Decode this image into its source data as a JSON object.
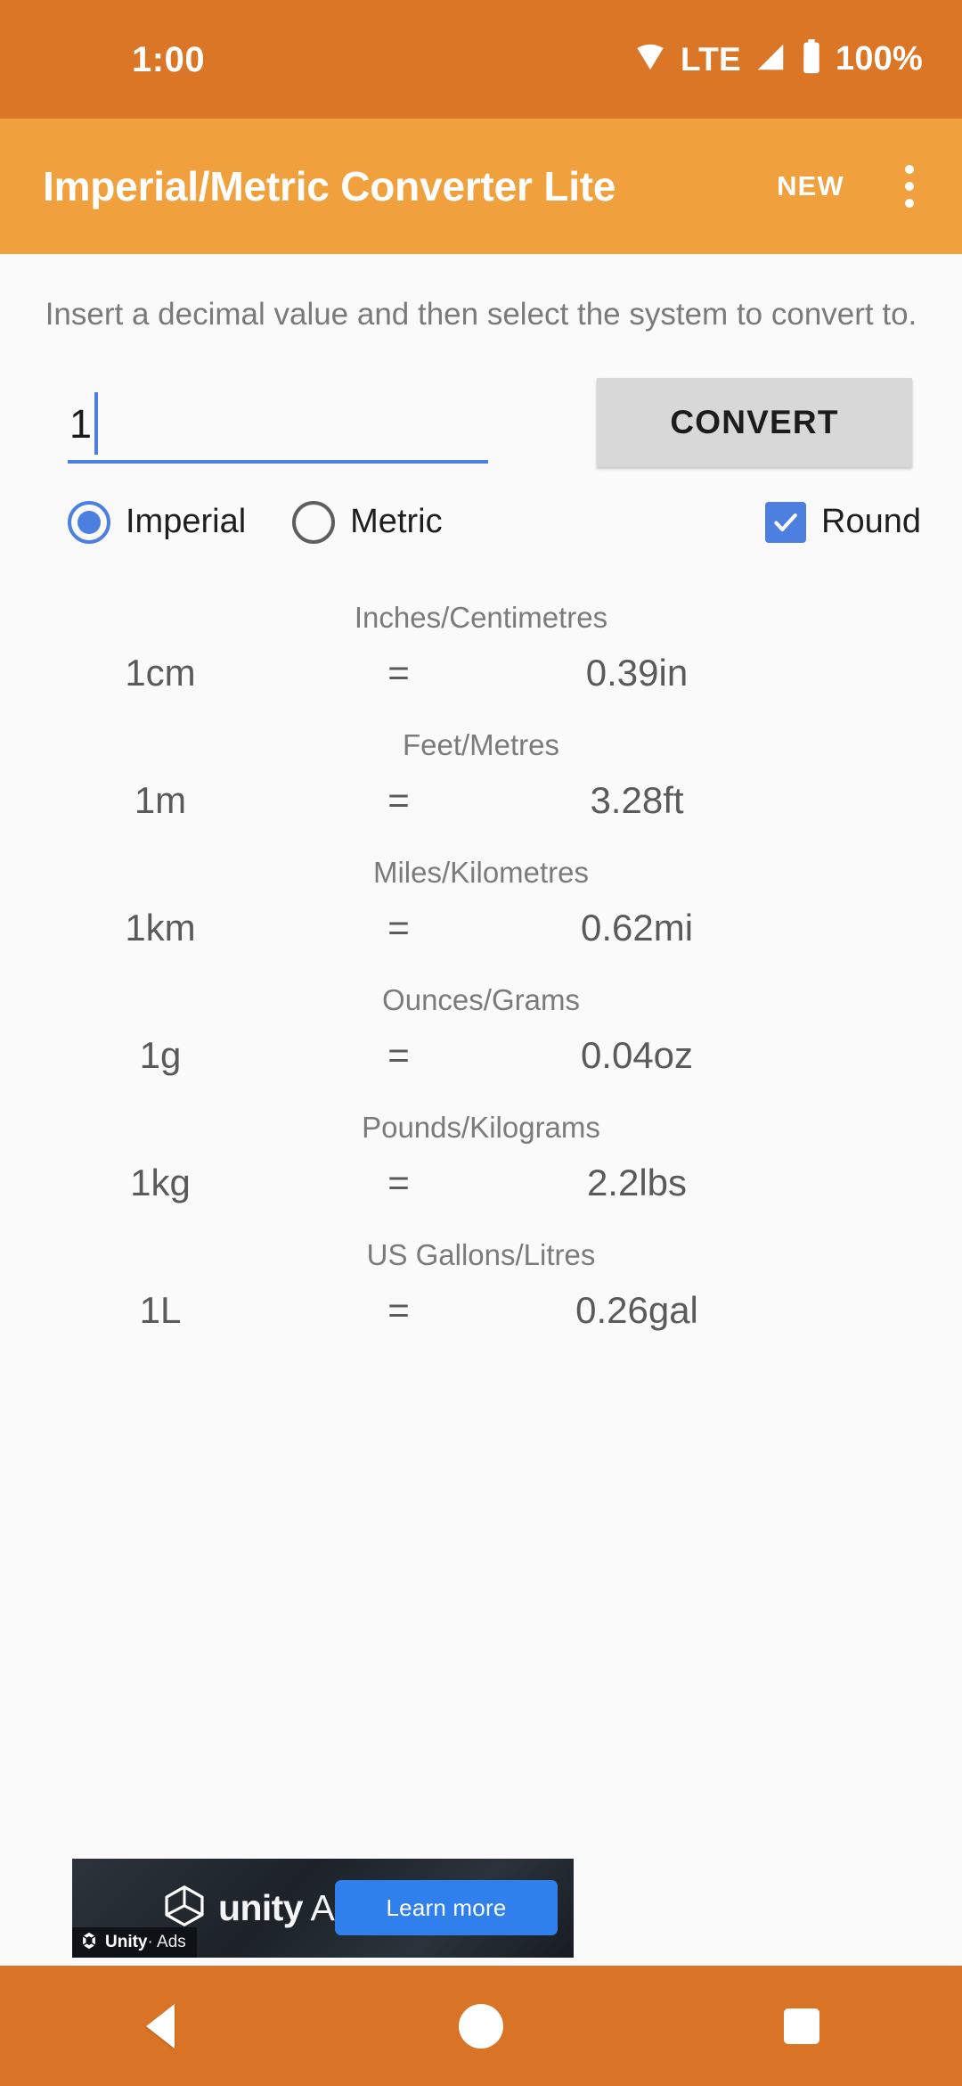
{
  "status_bar": {
    "clock": "1:00",
    "network_label": "LTE",
    "battery_label": "100%",
    "wifi_icon": "wifi-icon",
    "signal_icon": "cell-signal-icon",
    "battery_icon": "battery-full-icon",
    "background_color": "#DB7626"
  },
  "app_bar": {
    "title": "Imperial/Metric Converter Lite",
    "action_label": "NEW",
    "overflow_icon": "overflow-menu-icon",
    "background_color": "#F0A03C"
  },
  "main": {
    "hint": "Insert a decimal value and then select the system to convert to.",
    "input": {
      "value": "1",
      "placeholder": "",
      "accent_color": "#4C7FE0"
    },
    "convert_button": {
      "label": "CONVERT",
      "background_color": "#D8D8D8"
    },
    "options": {
      "system_label_imperial": "Imperial",
      "system_label_metric": "Metric",
      "selected_system": "Imperial",
      "round_label": "Round",
      "round_checked": true,
      "accent_color": "#4C7FE0"
    }
  },
  "results": [
    {
      "title": "Inches/Centimetres",
      "from": "1cm",
      "equals": "=",
      "to": "0.39in"
    },
    {
      "title": "Feet/Metres",
      "from": "1m",
      "equals": "=",
      "to": "3.28ft"
    },
    {
      "title": "Miles/Kilometres",
      "from": "1km",
      "equals": "=",
      "to": "0.62mi"
    },
    {
      "title": "Ounces/Grams",
      "from": "1g",
      "equals": "=",
      "to": "0.04oz"
    },
    {
      "title": "Pounds/Kilograms",
      "from": "1kg",
      "equals": "=",
      "to": "2.2lbs"
    },
    {
      "title": "US Gallons/Litres",
      "from": "1L",
      "equals": "=",
      "to": "0.26gal"
    }
  ],
  "ad": {
    "brand_bold": "unity",
    "brand_light": " Ads",
    "cta_label": "Learn more",
    "cta_color": "#2F7FEC",
    "badge_bold": "Unity",
    "badge_light": "· Ads",
    "logo_icon": "unity-cube-icon"
  },
  "nav_bar": {
    "back_label": "Back",
    "home_label": "Home",
    "recents_label": "Recents",
    "background_color": "#D97426"
  }
}
